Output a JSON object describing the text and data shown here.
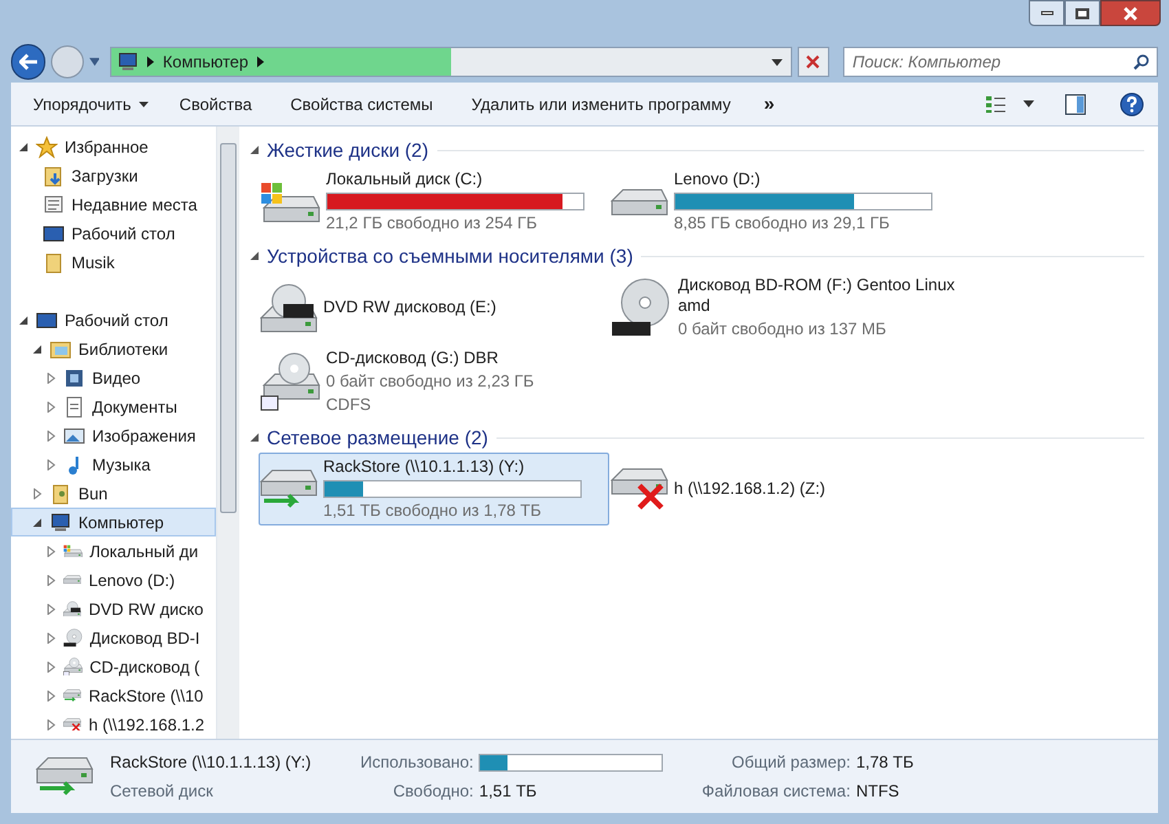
{
  "address_bar": {
    "crumbs": [
      "Компьютер"
    ],
    "level": 0.5
  },
  "search": {
    "placeholder": "Поиск: Компьютер"
  },
  "toolbar": {
    "items": [
      {
        "kind": "menu",
        "label": "Упорядочить"
      },
      {
        "kind": "button",
        "label": "Свойства"
      },
      {
        "kind": "button",
        "label": "Свойства системы"
      },
      {
        "kind": "button",
        "label": "Удалить или изменить программу"
      },
      {
        "kind": "more",
        "label": "»"
      }
    ]
  },
  "sidebar": {
    "items": [
      {
        "label": "Избранное",
        "kind": "star",
        "expanded": true,
        "selected": false,
        "children": [
          {
            "label": "Загрузки",
            "kind": "downloads",
            "selected": false
          },
          {
            "label": "Недавние места",
            "kind": "recent",
            "selected": false
          },
          {
            "label": "Рабочий стол",
            "kind": "desktop",
            "selected": false
          },
          {
            "label": "Musik",
            "kind": "folder",
            "selected": false
          }
        ]
      },
      {
        "label": "Рабочий стол",
        "kind": "desktop",
        "expanded": true,
        "selected": false,
        "children": [
          {
            "label": "Библиотеки",
            "kind": "library",
            "expanded": true,
            "selected": false,
            "children": [
              {
                "label": "Видео",
                "kind": "video",
                "expanded": false,
                "selected": false
              },
              {
                "label": "Документы",
                "kind": "document",
                "expanded": false,
                "selected": false
              },
              {
                "label": "Изображения",
                "kind": "image",
                "expanded": false,
                "selected": false
              },
              {
                "label": "Музыка",
                "kind": "music",
                "expanded": false,
                "selected": false
              }
            ]
          },
          {
            "label": "Bun",
            "kind": "userfolder",
            "expanded": false,
            "selected": false
          },
          {
            "label": "Компьютер",
            "kind": "computer",
            "expanded": true,
            "selected": true,
            "children": [
              {
                "label": "Локальный ди",
                "kind": "windisk",
                "expanded": false,
                "selected": false
              },
              {
                "label": "Lenovo (D:)",
                "kind": "disk",
                "expanded": false,
                "selected": false
              },
              {
                "label": "DVD RW диско",
                "kind": "dvd",
                "expanded": false,
                "selected": false
              },
              {
                "label": "Дисковод BD-I",
                "kind": "cd",
                "expanded": false,
                "selected": false
              },
              {
                "label": "CD-дисковод (",
                "kind": "cddrive",
                "expanded": false,
                "selected": false
              },
              {
                "label": "RackStore (\\\\10",
                "kind": "network",
                "expanded": false,
                "selected": false
              },
              {
                "label": "h (\\\\192.168.1.2",
                "kind": "offline",
                "expanded": false,
                "selected": false
              }
            ]
          }
        ]
      }
    ]
  },
  "groups": [
    {
      "title": "Жесткие диски (2)",
      "expanded": true,
      "items": [
        {
          "name": "Локальный диск (C:)",
          "kind": "windisk",
          "level": 0.92,
          "color": "#d71920",
          "lines": [
            "21,2 ГБ свободно из 254 ГБ"
          ],
          "selected": false
        },
        {
          "name": "Lenovo (D:)",
          "kind": "disk",
          "level": 0.7,
          "color": "#1f8fb4",
          "lines": [
            "8,85 ГБ свободно из 29,1 ГБ"
          ],
          "selected": false
        }
      ]
    },
    {
      "title": "Устройства со съемными носителями (3)",
      "expanded": true,
      "items": [
        {
          "name": "DVD RW дисковод (E:)",
          "kind": "dvd",
          "selected": false
        },
        {
          "name": "Дисковод BD-ROM (F:) Gentoo Linux amd",
          "kind": "cd",
          "lines": [
            "0 байт свободно из 137 МБ"
          ],
          "selected": false
        },
        {
          "name": "CD-дисковод (G:) DBR",
          "kind": "cddrive",
          "lines": [
            "0 байт свободно из 2,23 ГБ",
            "CDFS"
          ],
          "selected": false
        }
      ]
    },
    {
      "title": "Сетевое размещение (2)",
      "expanded": true,
      "items": [
        {
          "name": "RackStore (\\\\10.1.1.13) (Y:)",
          "kind": "network",
          "level": 0.15,
          "color": "#1f8fb4",
          "lines": [
            "1,51 ТБ свободно из 1,78 ТБ"
          ],
          "selected": true
        },
        {
          "name": "h (\\\\192.168.1.2) (Z:)",
          "kind": "offline",
          "selected": false
        }
      ]
    }
  ],
  "details": {
    "name": "RackStore (\\\\10.1.1.13) (Y:)",
    "type": "Сетевой диск",
    "kind": "network",
    "usage": {
      "label": "Использовано:",
      "level": 0.15
    },
    "fields": [
      {
        "label": "Свободно:",
        "value": "1,51 ТБ"
      },
      {
        "label": "Общий размер:",
        "value": "1,78 ТБ"
      },
      {
        "label": "Файловая система:",
        "value": "NTFS"
      }
    ]
  }
}
